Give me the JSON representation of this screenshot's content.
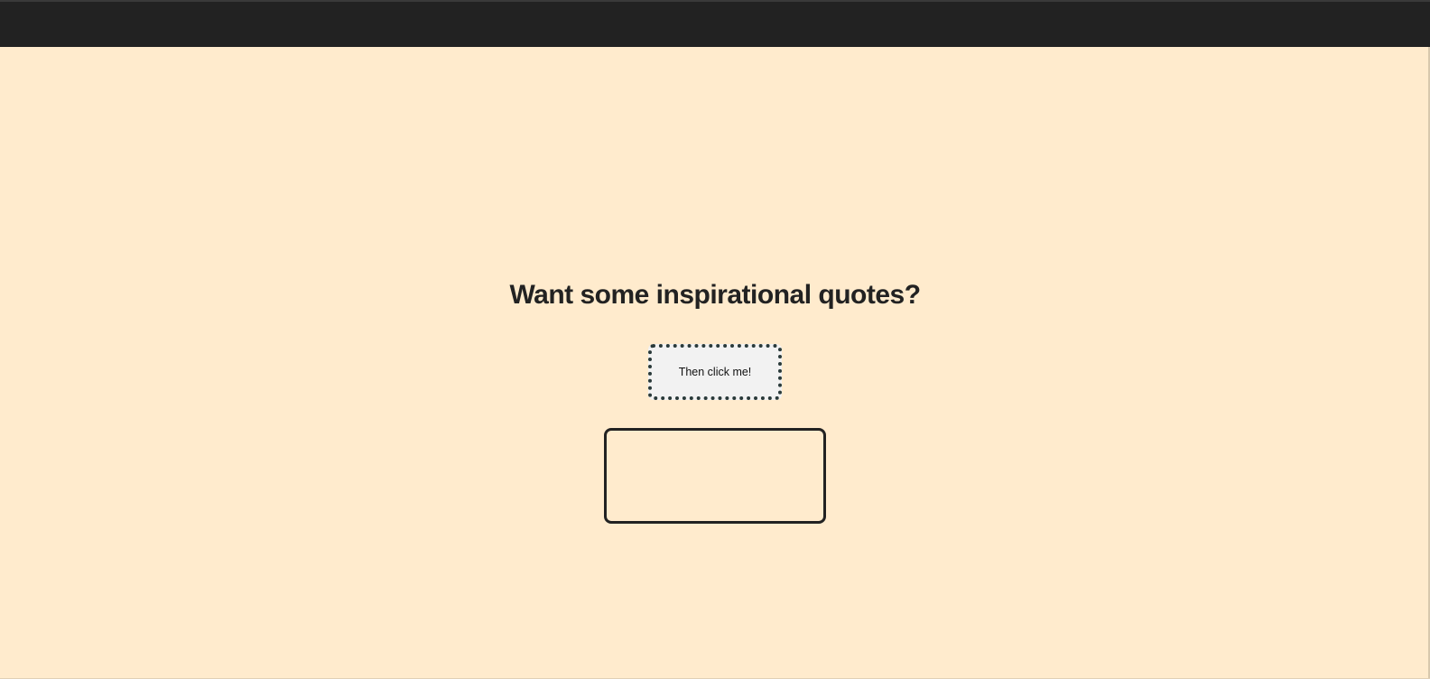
{
  "header": {
    "bar_color": "#222222"
  },
  "main": {
    "heading": "Want some inspirational quotes?",
    "button_label": "Then click me!",
    "quote_text": ""
  },
  "colors": {
    "background": "#ffebcd",
    "text": "#222222",
    "button_background": "#f2f2f2",
    "button_border": "#2a3a3a"
  }
}
